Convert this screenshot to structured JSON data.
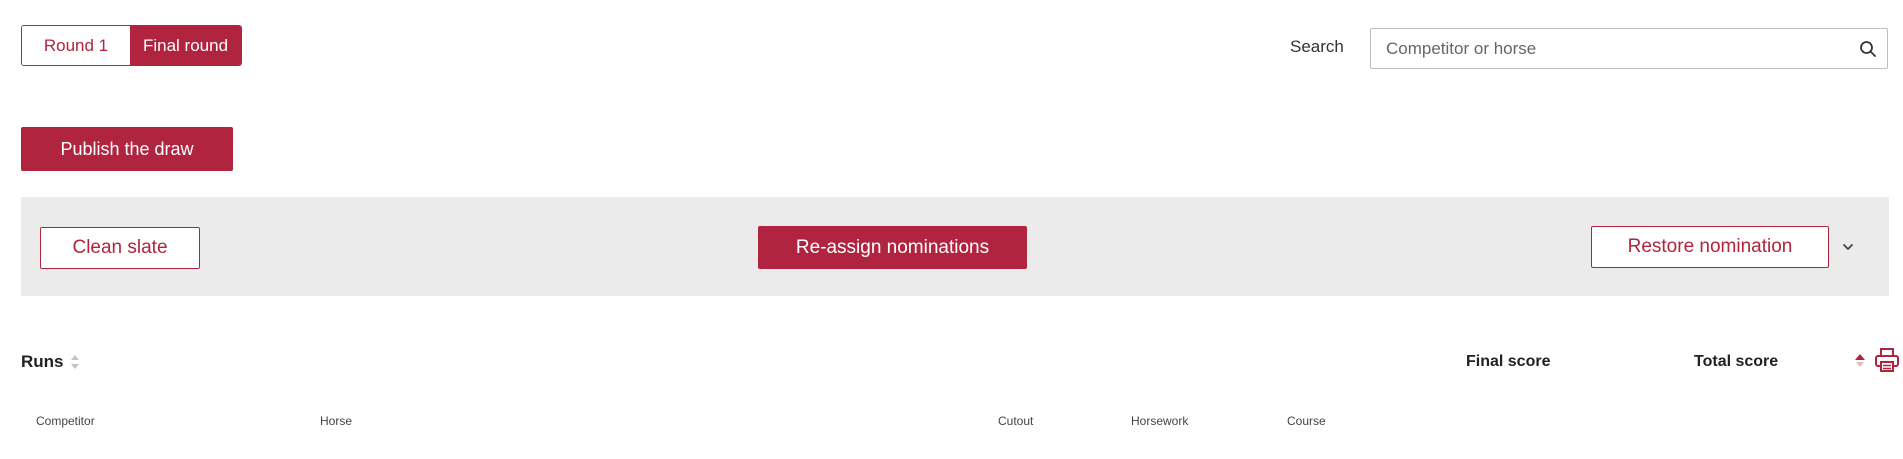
{
  "tabs": [
    {
      "label": "Round 1",
      "active": false
    },
    {
      "label": "Final round",
      "active": true
    }
  ],
  "search": {
    "label": "Search",
    "placeholder": "Competitor or horse",
    "value": "",
    "icon": "search-icon"
  },
  "actions": {
    "publish_label": "Publish the draw",
    "clean_slate_label": "Clean slate",
    "reassign_label": "Re-assign nominations",
    "restore_label": "Restore nomination"
  },
  "table": {
    "title": "Runs",
    "final_score_label": "Final score",
    "total_score_label": "Total score",
    "columns": [
      "Competitor",
      "Horse",
      "Cutout",
      "Horsework",
      "Course"
    ]
  },
  "colors": {
    "accent": "#b0243f",
    "bar_background": "#ebebeb"
  }
}
